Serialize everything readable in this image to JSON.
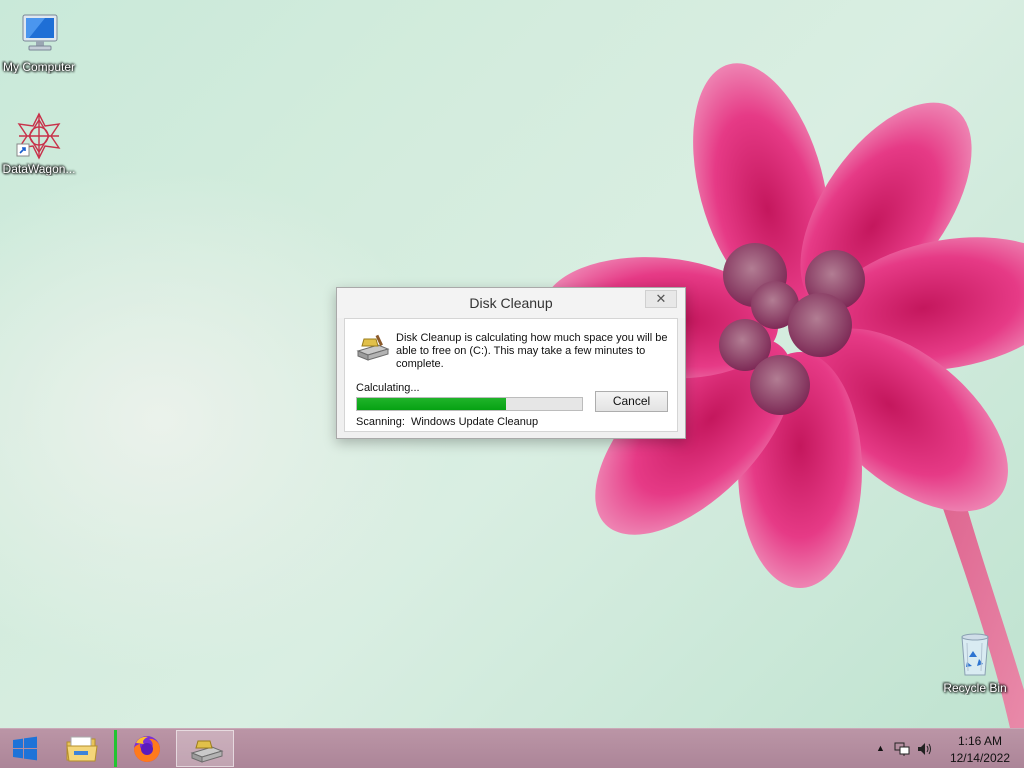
{
  "desktop": {
    "icons": [
      {
        "label": "My Computer",
        "icon": "computer-icon"
      },
      {
        "label": "DataWagon...",
        "icon": "datawagon-icon"
      },
      {
        "label": "Recycle Bin",
        "icon": "recycle-bin-icon"
      }
    ]
  },
  "dialog": {
    "title": "Disk Cleanup",
    "close_glyph": "✕",
    "message": "Disk Cleanup is calculating how much space you will be able to free on  (C:). This may take a few minutes to complete.",
    "calculating_label": "Calculating...",
    "progress_fraction": 0.66,
    "cancel_label": "Cancel",
    "scanning_label": "Scanning:",
    "scanning_item": "Windows Update Cleanup",
    "progress_color": "#06a213"
  },
  "taskbar": {
    "start_icon": "windows-logo-icon",
    "buttons": [
      {
        "icon": "file-explorer-icon"
      },
      {
        "icon": "firefox-icon"
      },
      {
        "icon": "disk-cleanup-icon",
        "active": true
      }
    ],
    "tray": {
      "show_hidden_glyph": "▲",
      "network_icon": "network-icon",
      "volume_icon": "volume-icon",
      "time": "1:16 AM",
      "date": "12/14/2022"
    }
  }
}
